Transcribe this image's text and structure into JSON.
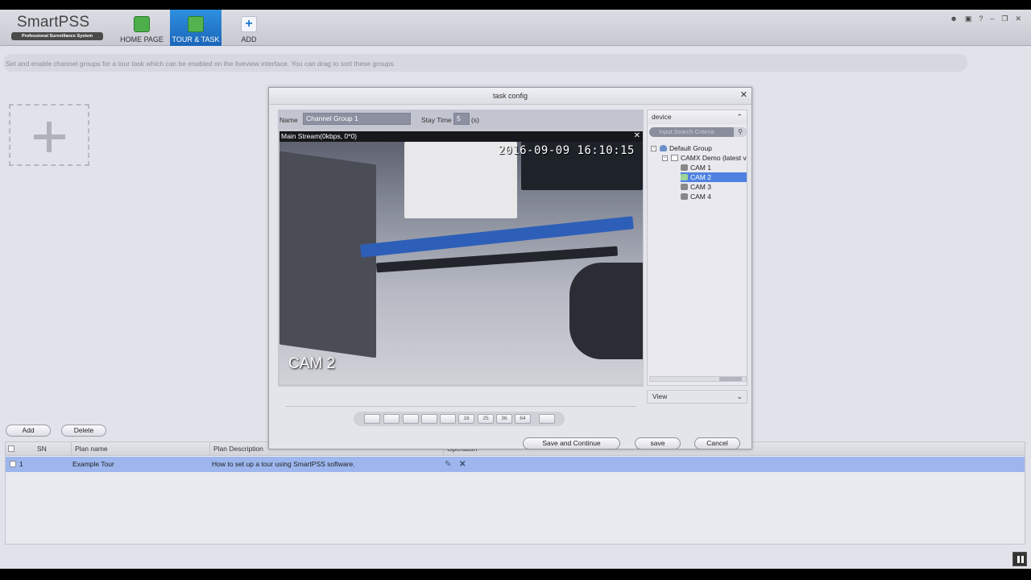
{
  "app": {
    "logo_name": "SmartPSS",
    "logo_tagline": "Professional Surveillance System"
  },
  "nav": {
    "home": "HOME PAGE",
    "tour": "TOUR & TASK",
    "add": "ADD"
  },
  "window_controls": [
    "user-icon",
    "lock-icon",
    "help-icon",
    "minimize-icon",
    "restore-icon",
    "close-icon"
  ],
  "hint": "Set and enable channel groups for a tour task which can be enabled on the liveview interface. You can drag to sort these groups.",
  "buttons": {
    "add": "Add",
    "delete": "Delete"
  },
  "table": {
    "headers": {
      "sn": "SN",
      "plan_name": "Plan name",
      "plan_description": "Plan Description",
      "operation": "Operation"
    },
    "rows": [
      {
        "sn": "1",
        "plan_name": "Example Tour",
        "plan_description": "How to set up a tour using SmartPSS software."
      }
    ]
  },
  "dialog": {
    "title": "task config",
    "name_label": "Name",
    "name_value": "Channel Group 1",
    "stay_label": "Stay Time",
    "stay_value": "5",
    "stay_unit": "(s)",
    "stream_info": "Main Stream(0kbps, 0*0)",
    "timestamp": "2016-09-09 16:10:15",
    "cam_label": "CAM 2",
    "device_header": "device",
    "search_placeholder": "Input Search Criteria",
    "tree": {
      "root": "Default Group",
      "device": "CAMX Demo (latest v",
      "cams": [
        "CAM 1",
        "CAM 2",
        "CAM 3",
        "CAM 4"
      ],
      "selected": "CAM 2"
    },
    "view_select": "View",
    "split_labels": [
      "",
      "",
      "",
      "",
      "",
      "16",
      "25",
      "36",
      "64",
      ""
    ],
    "save_continue": "Save and Continue",
    "save": "save",
    "cancel": "Cancel"
  },
  "colors": {
    "accent": "#1a66b8",
    "row_selected": "#9db6ee",
    "tree_selected": "#4f82e0"
  }
}
